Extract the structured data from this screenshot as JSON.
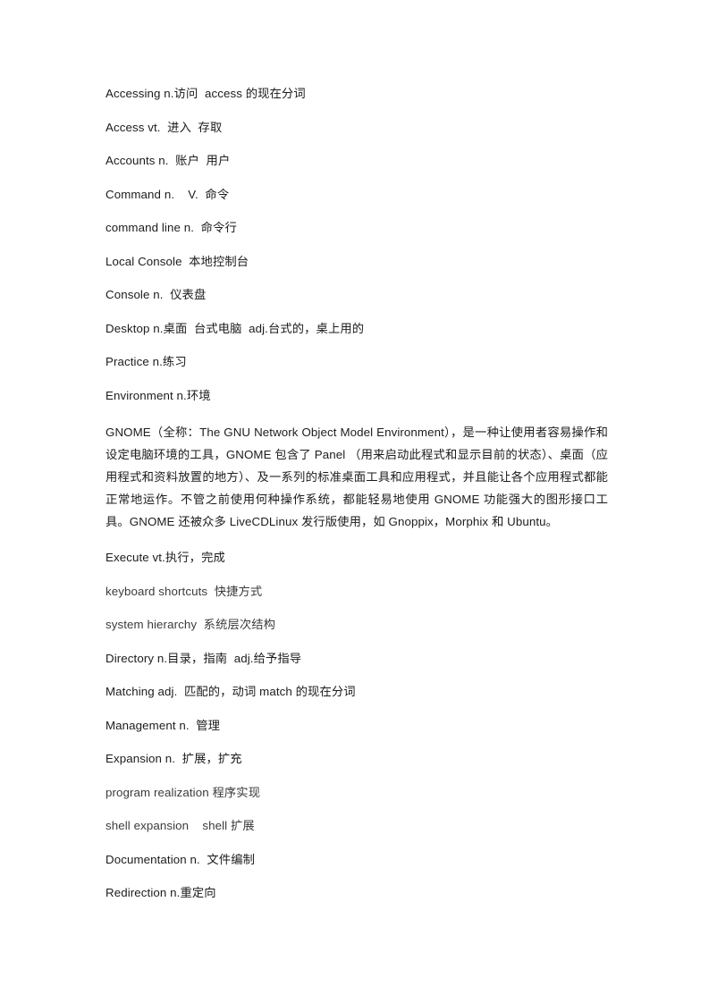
{
  "document": {
    "page_background": "#ffffff",
    "text_color": "#1c1c1c",
    "entries": [
      {
        "id": "accessing",
        "text": "Accessing n.访问  access 的现在分词"
      },
      {
        "id": "access",
        "text": "Access vt.  进入  存取"
      },
      {
        "id": "accounts",
        "text": "Accounts n.  账户  用户"
      },
      {
        "id": "command",
        "text": "Command n.    V.  命令"
      },
      {
        "id": "command-line",
        "text": "command line n.  命令行"
      },
      {
        "id": "local-console",
        "text": "Local Console  本地控制台"
      },
      {
        "id": "console",
        "text": "Console n.  仪表盘"
      },
      {
        "id": "desktop",
        "text": "Desktop n.桌面  台式电脑  adj.台式的，桌上用的"
      },
      {
        "id": "practice",
        "text": "Practice n.练习"
      },
      {
        "id": "environment",
        "text": "Environment n.环境"
      }
    ],
    "gnome_paragraph": {
      "id": "gnome-description",
      "text": "GNOME（全称：The GNU Network Object Model Environment），是一种让使用者容易操作和设定电脑环境的工具，GNOME 包含了 Panel （用来启动此程式和显示目前的状态）、桌面（应用程式和资料放置的地方）、及一系列的标准桌面工具和应用程式，并且能让各个应用程式都能正常地运作。不管之前使用何种操作系统，都能轻易地使用 GNOME 功能强大的图形接口工具。GNOME 还被众多 LiveCDLinux 发行版使用，如 Gnoppix，Morphix 和 Ubuntu。"
    },
    "entries_after": [
      {
        "id": "execute",
        "text": "Execute vt.执行，完成"
      },
      {
        "id": "keyboard-shortcuts",
        "text": "keyboard shortcuts  快捷方式"
      },
      {
        "id": "system-hierarchy",
        "text": "system hierarchy  系统层次结构"
      },
      {
        "id": "directory",
        "text": "Directory n.目录，指南  adj.给予指导"
      },
      {
        "id": "matching",
        "text": "Matching adj.  匹配的，动词 match 的现在分词"
      },
      {
        "id": "management",
        "text": "Management n.  管理"
      },
      {
        "id": "expansion",
        "text": "Expansion n.  扩展，扩充"
      },
      {
        "id": "program-realization",
        "text": "program realization 程序实现"
      },
      {
        "id": "shell-expansion",
        "text": "shell expansion    shell 扩展"
      },
      {
        "id": "documentation",
        "text": "Documentation n.  文件编制"
      },
      {
        "id": "redirection",
        "text": "Redirection n.重定向"
      }
    ]
  }
}
